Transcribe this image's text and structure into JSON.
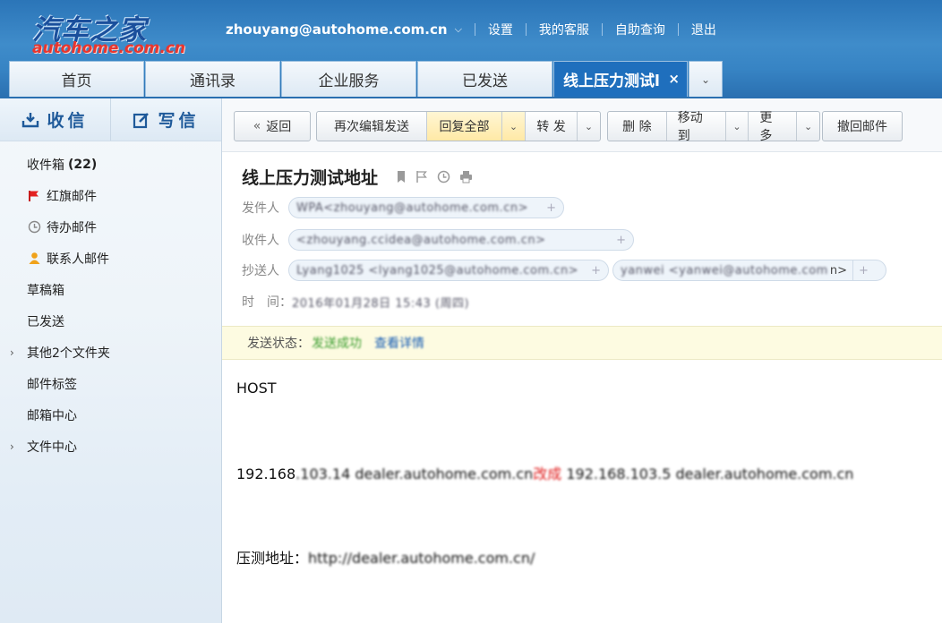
{
  "brand": {
    "logo_cn": "汽车之家",
    "logo_en": "autohome.com.cn"
  },
  "topnav": {
    "user": "zhouyang@autohome.com.cn",
    "links": [
      "设置",
      "我的客服",
      "自助查询",
      "退出"
    ]
  },
  "tabs": [
    {
      "label": "首页"
    },
    {
      "label": "通讯录"
    },
    {
      "label": "企业服务"
    },
    {
      "label": "已发送"
    },
    {
      "label": "线上压力测试l"
    }
  ],
  "sidebar": {
    "receive": "收信",
    "compose": "写信",
    "folders": [
      {
        "label": "收件箱",
        "count": "(22)"
      },
      {
        "label": "红旗邮件"
      },
      {
        "label": "待办邮件"
      },
      {
        "label": "联系人邮件"
      },
      {
        "label": "草稿箱"
      },
      {
        "label": "已发送"
      },
      {
        "label": "其他2个文件夹"
      },
      {
        "label": "邮件标签"
      },
      {
        "label": "邮箱中心"
      },
      {
        "label": "文件中心"
      }
    ]
  },
  "toolbar": {
    "back": "返回",
    "reedit": "再次编辑发送",
    "reply_all": "回复全部",
    "forward": "转 发",
    "delete": "删 除",
    "move_to": "移动到",
    "more": "更 多",
    "recall": "撤回邮件"
  },
  "mail": {
    "subject": "线上压力测试地址",
    "from_label": "发件人",
    "from_value": "WPA<zhouyang@autohome.com.cn>",
    "to_label": "收件人",
    "to_value": "<zhouyang.ccidea@autohome.com.cn>",
    "cc_label": "抄送人",
    "cc_value_1": "Lyang1025 <lyang1025@autohome.com.cn>",
    "cc_value_2": "yanwei <yanwei@autohome.com",
    "cc_tail": "n>",
    "time_label": "时　间：",
    "time_value": "2016年01月28日 15:43 (周四)",
    "status_label": "发送状态：",
    "status_value": "发送成功",
    "status_detail": "查看详情"
  },
  "body": {
    "host": "HOST",
    "line1_start": "192.168",
    "line1_blur": ".103.14  dealer.autohome.com.cn",
    "line1_red": "改成",
    "line1_blur2": " 192.168.103.5  dealer.autohome.com.cn",
    "line2_start": "压测地址：",
    "line2_blur": "http://dealer.autohome.com.cn/"
  }
}
